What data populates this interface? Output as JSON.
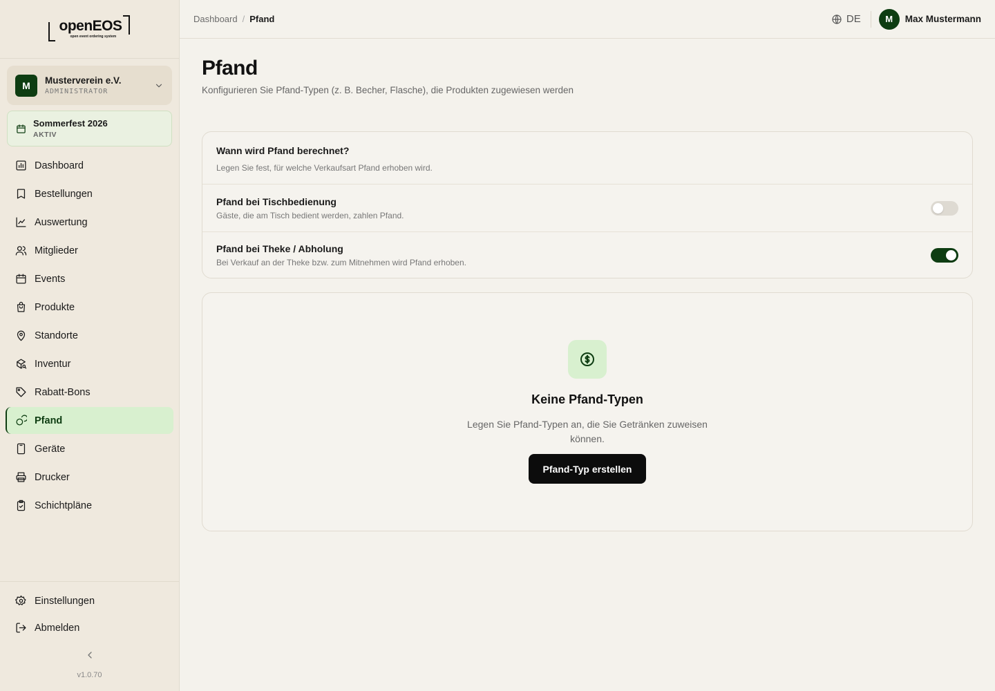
{
  "brand": {
    "logo_text": "openEOS",
    "logo_tagline": "open event ordering system"
  },
  "org": {
    "initial": "M",
    "name": "Musterverein e.V.",
    "role": "ADMINISTRATOR"
  },
  "event": {
    "name": "Sommerfest 2026",
    "status": "AKTIV"
  },
  "nav": {
    "items": [
      {
        "label": "Dashboard",
        "icon": "bar-chart-icon"
      },
      {
        "label": "Bestellungen",
        "icon": "receipt-icon"
      },
      {
        "label": "Auswertung",
        "icon": "line-chart-icon"
      },
      {
        "label": "Mitglieder",
        "icon": "users-icon"
      },
      {
        "label": "Events",
        "icon": "calendar-icon"
      },
      {
        "label": "Produkte",
        "icon": "shopping-bag-icon"
      },
      {
        "label": "Standorte",
        "icon": "map-pin-icon"
      },
      {
        "label": "Inventur",
        "icon": "package-search-icon"
      },
      {
        "label": "Rabatt-Bons",
        "icon": "tag-icon"
      },
      {
        "label": "Pfand",
        "icon": "coins-icon",
        "active": true
      },
      {
        "label": "Geräte",
        "icon": "tablet-icon"
      },
      {
        "label": "Drucker",
        "icon": "printer-icon"
      },
      {
        "label": "Schichtpläne",
        "icon": "clipboard-check-icon"
      }
    ],
    "bottom": [
      {
        "label": "Einstellungen",
        "icon": "gear-icon"
      },
      {
        "label": "Abmelden",
        "icon": "logout-icon"
      }
    ]
  },
  "version": "v1.0.70",
  "header": {
    "breadcrumb": [
      "Dashboard",
      "Pfand"
    ],
    "breadcrumb_sep": "/",
    "language": "DE",
    "user": {
      "initial": "M",
      "name": "Max Mustermann"
    }
  },
  "page": {
    "title": "Pfand",
    "subtitle": "Konfigurieren Sie Pfand-Typen (z. B. Becher, Flasche), die Produkten zugewiesen werden"
  },
  "settings": {
    "title": "Wann wird Pfand berechnet?",
    "description": "Legen Sie fest, für welche Verkaufsart Pfand erhoben wird.",
    "rows": [
      {
        "title": "Pfand bei Tischbedienung",
        "description": "Gäste, die am Tisch bedient werden, zahlen Pfand.",
        "enabled": false
      },
      {
        "title": "Pfand bei Theke / Abholung",
        "description": "Bei Verkauf an der Theke bzw. zum Mitnehmen wird Pfand erhoben.",
        "enabled": true
      }
    ]
  },
  "empty_state": {
    "icon": "coin-icon",
    "title": "Keine Pfand-Typen",
    "description": "Legen Sie Pfand-Typen an, die Sie Getränken zuweisen können.",
    "button_label": "Pfand-Typ erstellen"
  },
  "colors": {
    "accent": "#0e3d12",
    "accent_light": "#d8f0cf",
    "background": "#f4f2ec",
    "sidebar": "#efe9de"
  }
}
